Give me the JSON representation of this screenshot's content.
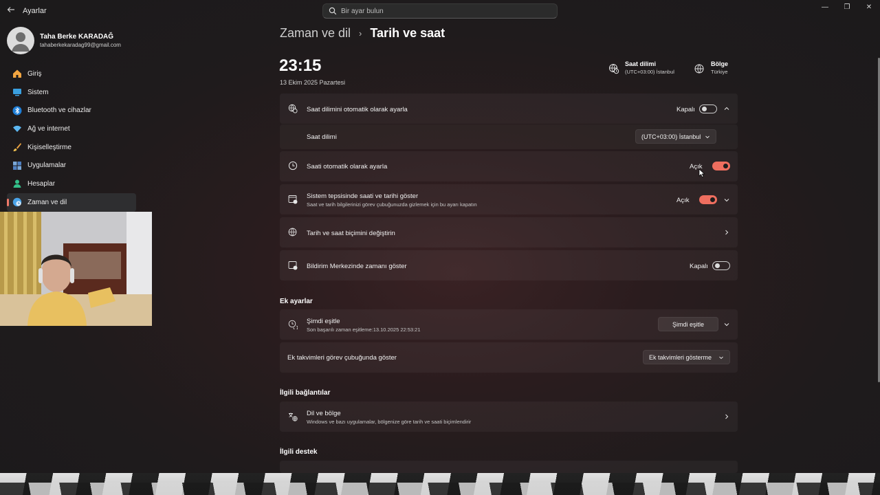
{
  "window": {
    "app_title": "Ayarlar",
    "search_placeholder": "Bir ayar bulun"
  },
  "profile": {
    "name": "Taha Berke KARADAĞ",
    "email": "tahaberkekaradag99@gmail.com"
  },
  "sidebar": {
    "items": [
      {
        "label": "Giriş",
        "icon": "home-icon",
        "color": "#f2a541"
      },
      {
        "label": "Sistem",
        "icon": "system-icon",
        "color": "#3aa0e0"
      },
      {
        "label": "Bluetooth ve cihazlar",
        "icon": "bluetooth-icon",
        "color": "#1f7fd8"
      },
      {
        "label": "Ağ ve internet",
        "icon": "network-icon",
        "color": "#5cb6f0"
      },
      {
        "label": "Kişiselleştirme",
        "icon": "brush-icon",
        "color": "#e8a040"
      },
      {
        "label": "Uygulamalar",
        "icon": "apps-icon",
        "color": "#7aa7d8"
      },
      {
        "label": "Hesaplar",
        "icon": "accounts-icon",
        "color": "#34c08a"
      },
      {
        "label": "Zaman ve dil",
        "icon": "time-language-icon",
        "color": "#4aa3e8",
        "active": true
      }
    ]
  },
  "header": {
    "parent": "Zaman ve dil",
    "current": "Tarih ve saat"
  },
  "clock": {
    "time": "23:15",
    "date": "13 Ekim 2025 Pazartesi"
  },
  "meta": {
    "timezone_label": "Saat dilimi",
    "timezone_value": "(UTC+03:00) İstanbul",
    "region_label": "Bölge",
    "region_value": "Türkiye"
  },
  "settings": {
    "auto_timezone": {
      "title": "Saat dilimini otomatik olarak ayarla",
      "state": "Kapalı",
      "on": false
    },
    "timezone_row": {
      "title": "Saat dilimi",
      "value": "(UTC+03:00) İstanbul"
    },
    "auto_time": {
      "title": "Saati otomatik olarak ayarla",
      "state": "Açık",
      "on": true
    },
    "tray": {
      "title": "Sistem tepsisinde saati ve tarihi göster",
      "subtitle": "Saat ve tarih bilgilerinizi görev çubuğunuzda gizlemek için bu ayarı kapatın",
      "state": "Açık",
      "on": true
    },
    "format": {
      "title": "Tarih ve saat biçimini değiştirin"
    },
    "notification": {
      "title": "Bildirim Merkezinde zamanı göster",
      "state": "Kapalı",
      "on": false
    }
  },
  "extra": {
    "heading": "Ek ayarlar",
    "sync": {
      "title": "Şimdi eşitle",
      "subtitle": "Son başarılı zaman eşitleme:13.10.2025 22:53:21",
      "button": "Şimdi eşitle"
    },
    "calendars": {
      "title": "Ek takvimleri görev çubuğunda göster",
      "value": "Ek takvimleri gösterme"
    }
  },
  "related": {
    "heading": "İlgili bağlantılar",
    "language_region": {
      "title": "Dil ve bölge",
      "subtitle": "Windows ve bazı uygulamalar, bölgenize göre tarih ve saati biçimlendirir"
    }
  },
  "support": {
    "heading": "İlgili destek"
  },
  "accent_color": "#ee6e5f"
}
